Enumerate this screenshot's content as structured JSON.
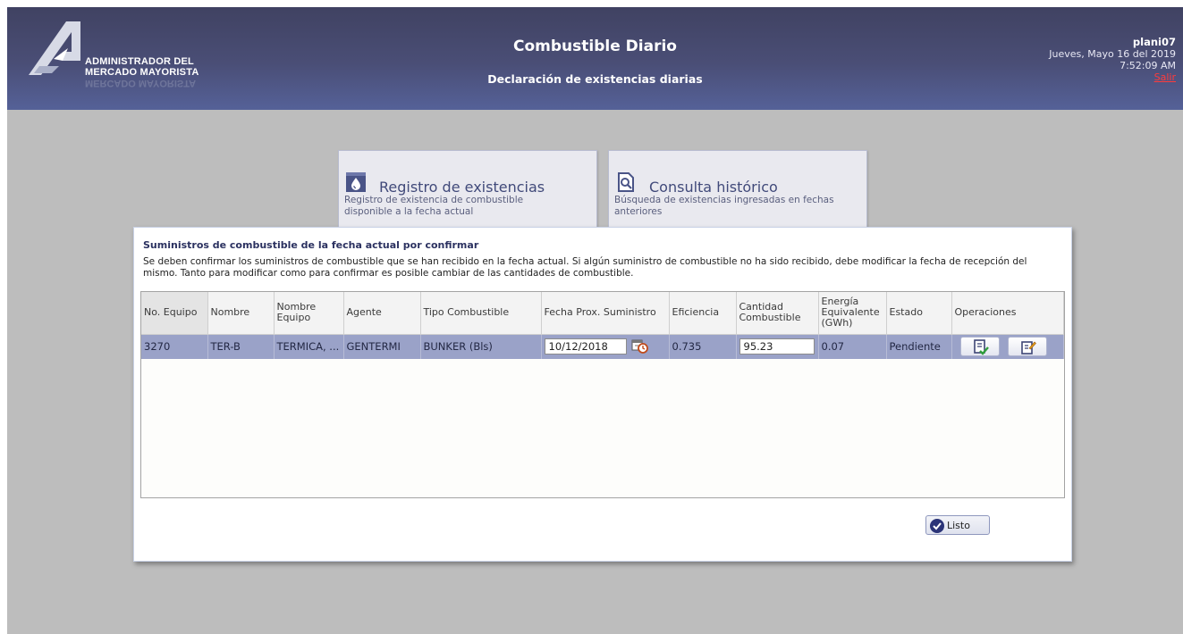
{
  "header": {
    "logo_line1": "ADMINISTRADOR DEL",
    "logo_line2": "MERCADO MAYORISTA",
    "title": "Combustible Diario",
    "subtitle": "Declaración de existencias diarias",
    "user": "plani07",
    "date": "Jueves, Mayo 16 del 2019",
    "time": "7:52:09 AM",
    "logout": "Salir"
  },
  "cards": [
    {
      "icon": "fuel-drop-icon",
      "title": "Registro de existencias",
      "desc_line1": "Registro de existencia de combustible",
      "desc_line2": "disponible a la fecha actual"
    },
    {
      "icon": "document-search-icon",
      "title": "Consulta histórico",
      "desc_line1": "Búsqueda de existencias ingresadas en fechas",
      "desc_line2": "anteriores"
    }
  ],
  "modal": {
    "title": "Suministros de combustible de la fecha actual por confirmar",
    "message": "Se deben confirmar los suministros de combustible que se han recibido en la fecha actual. Si algún suministro de combustible no ha sido recibido, debe modificar la fecha de recepción del mismo. Tanto para modificar como para confirmar es posible cambiar de las cantidades de combustible.",
    "columns": [
      "No. Equipo",
      "Nombre",
      "Nombre Equipo",
      "Agente",
      "Tipo Combustible",
      "Fecha Prox. Suministro",
      "Eficiencia",
      "Cantidad Combustible",
      "Energía Equivalente (GWh)",
      "Estado",
      "Operaciones"
    ],
    "rows": [
      {
        "no_equipo": "3270",
        "nombre": "TER-B",
        "nombre_equipo": "TERMICA, ...",
        "agente": "GENTERMI",
        "tipo": "BUNKER (Bls)",
        "fecha": "10/12/2018",
        "eficiencia": "0.735",
        "cantidad": "95.23",
        "energia": "0.07",
        "estado": "Pendiente"
      }
    ],
    "done_label": "Listo"
  },
  "colors": {
    "header_dark": "#404262",
    "selected_row": "#9aa2c8",
    "logout": "#ff3b3b",
    "confirm_green": "#2f9e3a"
  }
}
